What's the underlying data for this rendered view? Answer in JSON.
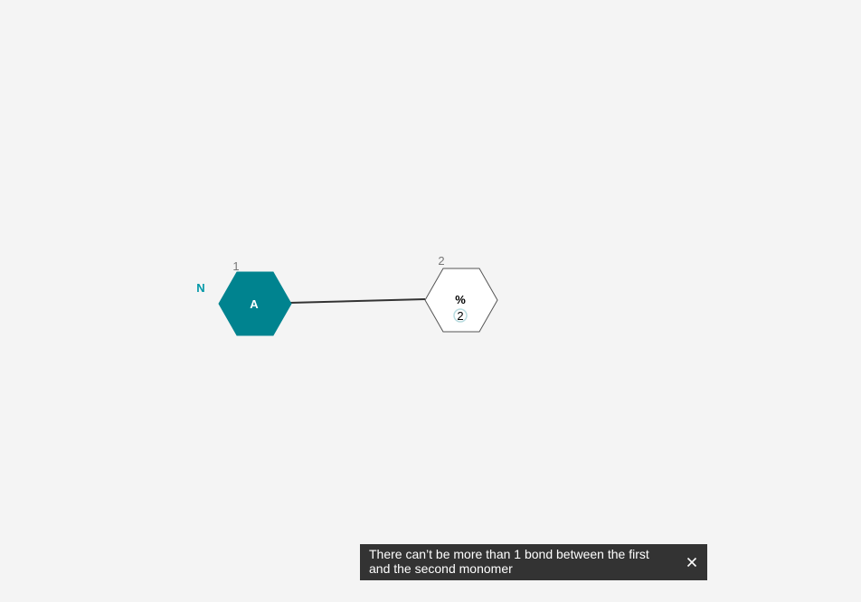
{
  "canvas": {
    "terminal_label": "N",
    "monomers": [
      {
        "number": "1",
        "symbol": "A",
        "fill": "#00838f",
        "stroke": "#00838f",
        "text_color": "#ffffff"
      },
      {
        "number": "2",
        "symbol": "%",
        "badge": "2",
        "fill": "#ffffff",
        "stroke": "#555555",
        "text_color": "#000000"
      }
    ],
    "bond_color": "#333333",
    "label_accent": "#0097a7"
  },
  "notification": {
    "message": "There can’t be more than 1 bond between the first and the second monomer",
    "close_icon": "close-icon"
  }
}
